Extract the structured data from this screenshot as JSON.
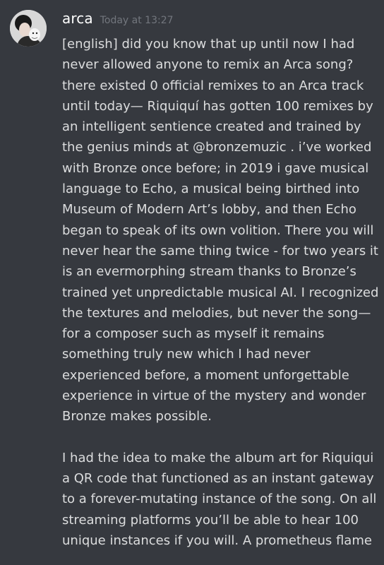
{
  "message": {
    "author": "arca",
    "timestamp": "Today at 13:27",
    "paragraphs": [
      "[english] did you know that up until now I had never allowed anyone to remix an Arca song? there existed 0 official remixes to an Arca track until today— Riquiquí has gotten 100 remixes by an intelligent sentience created and trained by the genius minds at @bronzemuzic . i’ve worked with Bronze once before; in 2019 i gave musical language to Echo, a musical being birthed into Museum of Modern Art’s lobby, and then Echo began to speak of its own volition. There you will never hear the same thing twice - for two years it is an evermorphing stream thanks to Bronze’s trained yet unpredictable musical AI. I recognized the textures and melodies, but never the song— for a composer such as myself it remains something truly new which I had never experienced before, a moment unforgettable experience in virtue of the mystery and wonder Bronze makes possible.",
      "I had the idea to make the album art for Riquiqui a QR code that functioned as an instant gateway to a forever-mutating instance of the song. On all streaming platforms you’ll be able to hear 100 unique instances if you will. A prometheus flame"
    ]
  }
}
